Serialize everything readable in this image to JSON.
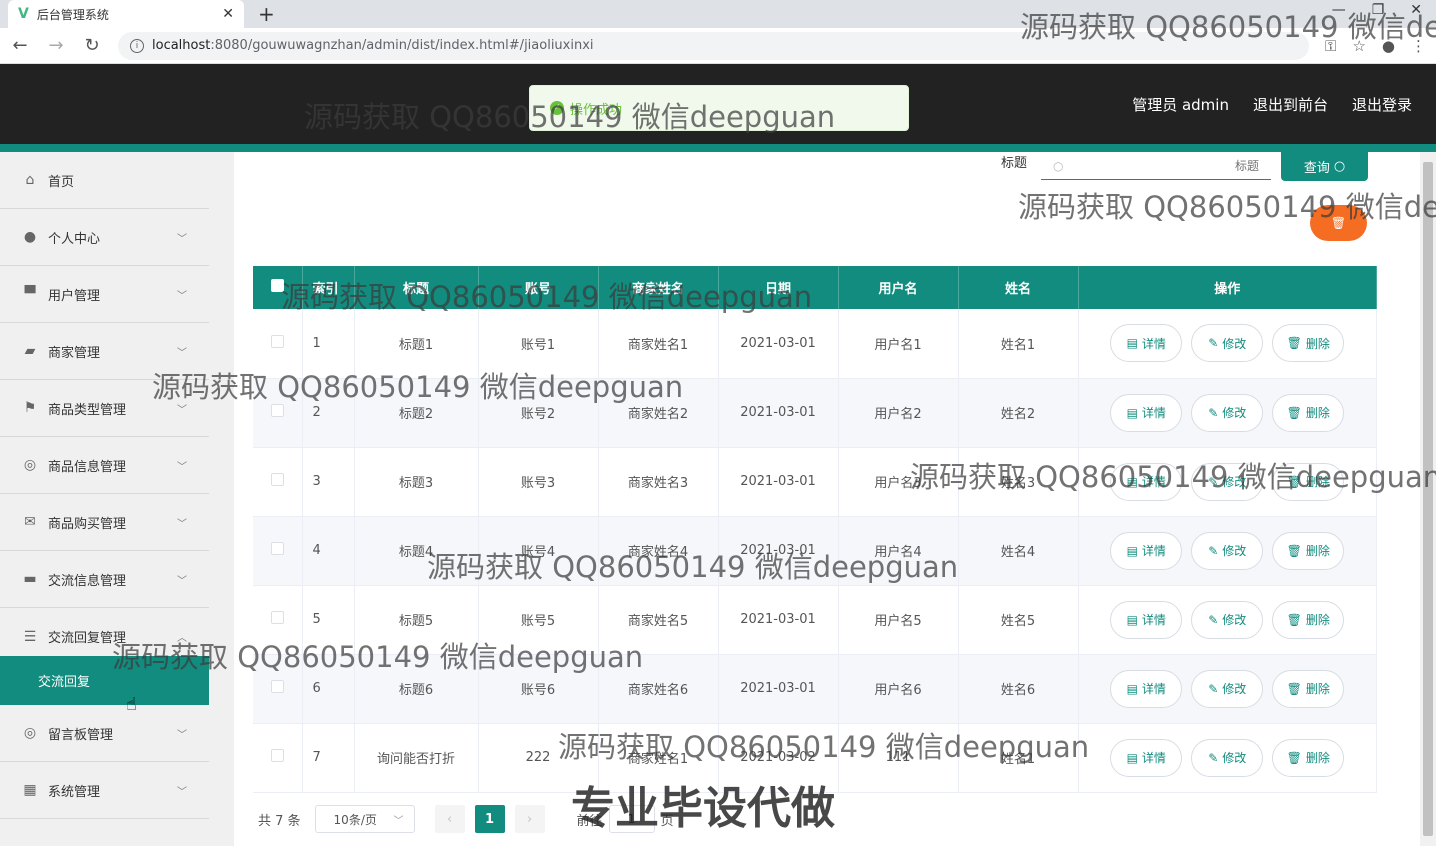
{
  "browser": {
    "tab_title": "后台管理系统",
    "url_host": "localhost",
    "url_path": ":8080/gouwuwagnzhan/admin/dist/index.html#/jiaoliuxinxi"
  },
  "header": {
    "admin_label": "管理员 admin",
    "back_front": "退出到前台",
    "logout": "退出登录",
    "toast": "操作成功"
  },
  "sidebar": {
    "items": [
      {
        "label": "首页",
        "icon": "home-icon"
      },
      {
        "label": "个人中心",
        "icon": "user-icon"
      },
      {
        "label": "用户管理",
        "icon": "sign-icon"
      },
      {
        "label": "商家管理",
        "icon": "shop-icon"
      },
      {
        "label": "商品类型管理",
        "icon": "flag-icon"
      },
      {
        "label": "商品信息管理",
        "icon": "info-icon"
      },
      {
        "label": "商品购买管理",
        "icon": "mail-icon"
      },
      {
        "label": "交流信息管理",
        "icon": "chat-icon"
      },
      {
        "label": "交流回复管理",
        "icon": "sliders-icon"
      },
      {
        "label": "留言板管理",
        "icon": "target-icon"
      },
      {
        "label": "系统管理",
        "icon": "grid-icon"
      }
    ],
    "active_sub": "交流回复"
  },
  "search": {
    "label": "标题",
    "placeholder": "标题",
    "query_button": "查询"
  },
  "table": {
    "headers": [
      "索引",
      "标题",
      "账号",
      "商家姓名",
      "日期",
      "用户名",
      "姓名",
      "操作"
    ],
    "rows": [
      [
        "1",
        "标题1",
        "账号1",
        "商家姓名1",
        "2021-03-01",
        "用户名1",
        "姓名1"
      ],
      [
        "2",
        "标题2",
        "账号2",
        "商家姓名2",
        "2021-03-01",
        "用户名2",
        "姓名2"
      ],
      [
        "3",
        "标题3",
        "账号3",
        "商家姓名3",
        "2021-03-01",
        "用户名3",
        "姓名3"
      ],
      [
        "4",
        "标题4",
        "账号4",
        "商家姓名4",
        "2021-03-01",
        "用户名4",
        "姓名4"
      ],
      [
        "5",
        "标题5",
        "账号5",
        "商家姓名5",
        "2021-03-01",
        "用户名5",
        "姓名5"
      ],
      [
        "6",
        "标题6",
        "账号6",
        "商家姓名6",
        "2021-03-01",
        "用户名6",
        "姓名6"
      ],
      [
        "7",
        "询问能否打折",
        "222",
        "商家姓名1",
        "2021-03-02",
        "111",
        "姓名1"
      ]
    ],
    "ops": {
      "detail": "详情",
      "edit": "修改",
      "delete": "删除"
    }
  },
  "pagination": {
    "total": "共 7 条",
    "page_size": "10条/页",
    "current": "1",
    "goto_prefix": "前往",
    "goto_value": "1",
    "goto_suffix": "页"
  },
  "watermark": {
    "text": "源码获取 QQ86050149 微信deepguan",
    "big": "专业毕设代做"
  },
  "colors": {
    "primary": "#128c7e",
    "header_bg": "#222222",
    "delete_orange": "#f56c23",
    "toast_green": "#67c23a"
  }
}
